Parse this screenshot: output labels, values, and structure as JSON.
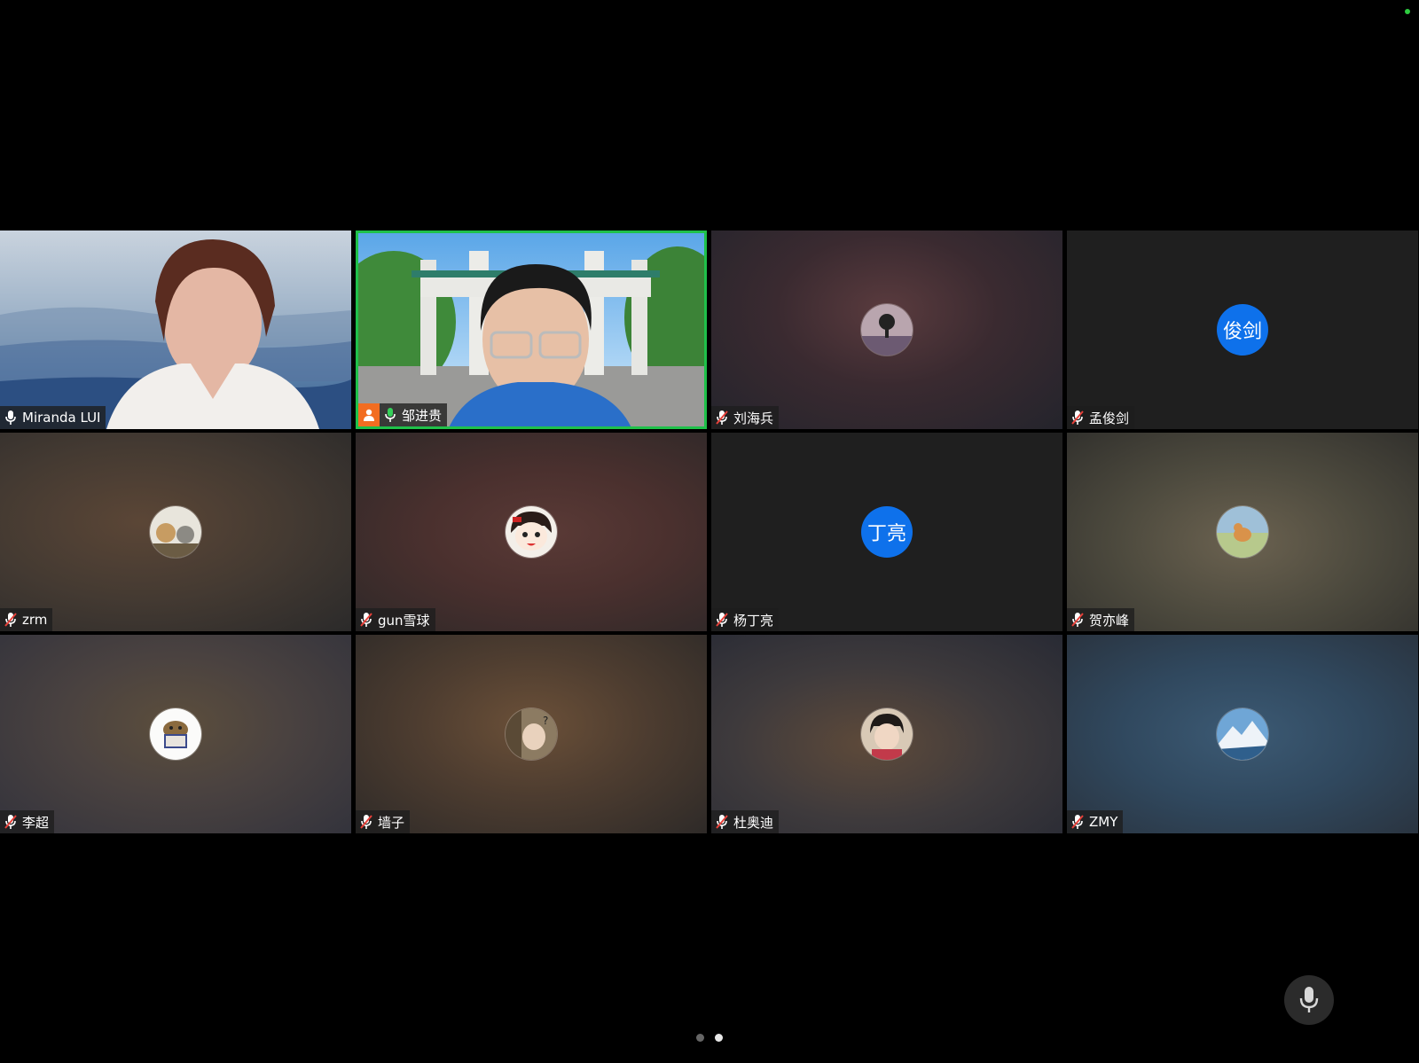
{
  "colors": {
    "background": "#000000",
    "speaking_border": "#1fc14a",
    "host_badge": "#f26d21",
    "initials_avatar": "#0e71eb",
    "muted_red": "#e8413a",
    "status_green": "#2ecc40"
  },
  "participants": [
    {
      "name": "Miranda LUI",
      "mic": "on",
      "kind": "video-landscape"
    },
    {
      "name": "邹进贵",
      "mic": "on",
      "kind": "video-gate",
      "host": true,
      "speaking": true
    },
    {
      "name": "刘海兵",
      "mic": "muted",
      "kind": "avatar-photo"
    },
    {
      "name": "孟俊剑",
      "mic": "muted",
      "kind": "avatar-initials",
      "initials": "俊剑"
    },
    {
      "name": "zrm",
      "mic": "muted",
      "kind": "avatar-photo"
    },
    {
      "name": "gun雪球",
      "mic": "muted",
      "kind": "avatar-photo"
    },
    {
      "name": "杨丁亮",
      "mic": "muted",
      "kind": "avatar-initials",
      "initials": "丁亮"
    },
    {
      "name": "贺亦峰",
      "mic": "muted",
      "kind": "avatar-photo"
    },
    {
      "name": "李超",
      "mic": "muted",
      "kind": "avatar-photo"
    },
    {
      "name": "墙子",
      "mic": "muted",
      "kind": "avatar-photo"
    },
    {
      "name": "杜奥迪",
      "mic": "muted",
      "kind": "avatar-photo"
    },
    {
      "name": "ZMY",
      "mic": "muted",
      "kind": "avatar-photo"
    }
  ],
  "pagination": {
    "pages": 2,
    "current": 2
  },
  "icons": {
    "mic": "microphone-icon",
    "muted": "microphone-muted-icon",
    "host": "host-person-icon"
  }
}
